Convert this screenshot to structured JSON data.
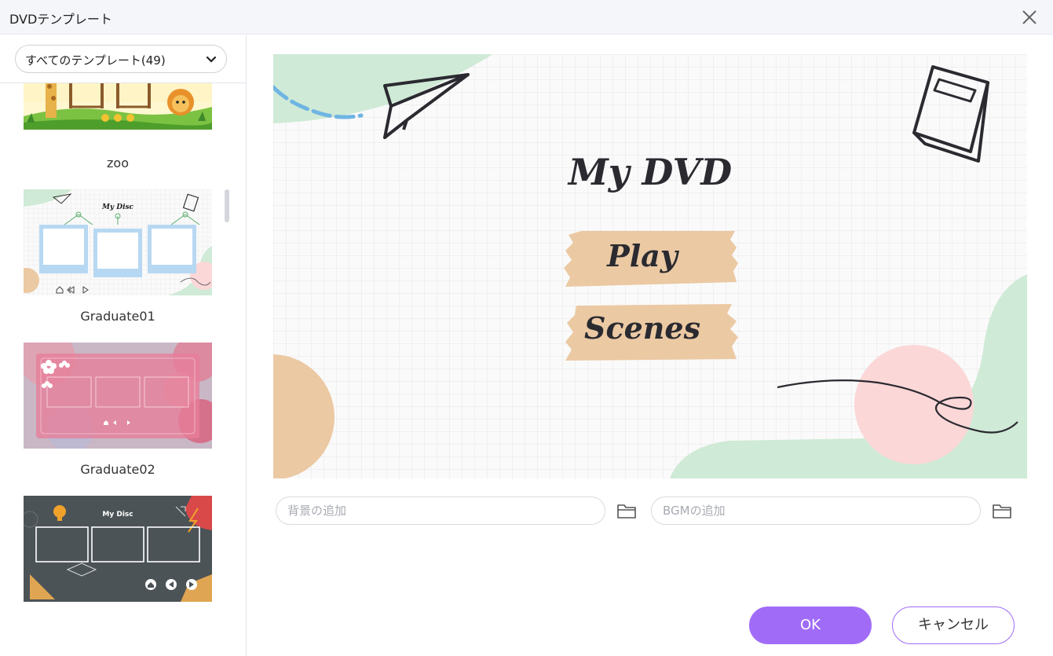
{
  "window": {
    "title": "DVDテンプレート"
  },
  "filter": {
    "selected": "すべてのテンプレート(49)"
  },
  "templates": [
    {
      "name": "zoo"
    },
    {
      "name": "Graduate01",
      "preview_title": "My Disc"
    },
    {
      "name": "Graduate02"
    },
    {
      "name": "",
      "preview_title": "My Disc"
    }
  ],
  "preview": {
    "title": "My DVD",
    "buttons": [
      "Play",
      "Scenes"
    ]
  },
  "background_input": {
    "placeholder": "背景の追加",
    "value": ""
  },
  "bgm_input": {
    "placeholder": "BGMの追加",
    "value": ""
  },
  "actions": {
    "ok": "OK",
    "cancel": "キャンセル"
  },
  "colors": {
    "accent": "#a06cf7",
    "mint": "#cfead6",
    "peach": "#ebc9a3",
    "pink": "#fbd7d8",
    "ink": "#2a2a30"
  }
}
